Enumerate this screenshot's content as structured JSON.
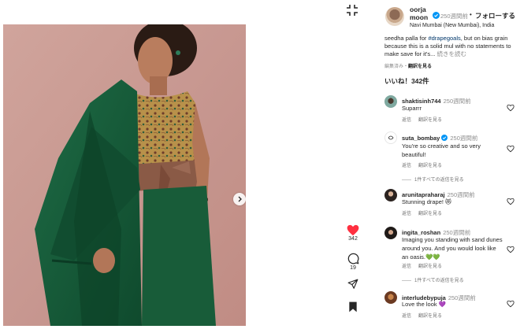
{
  "post": {
    "username": "oorjamoon",
    "time": "250週間前",
    "follow_label": "フォローする",
    "dot": "•",
    "location": "Navi Mumbai (New Mumbai), India"
  },
  "caption": {
    "pre": "seedha palla for ",
    "hashtag": "#drapegoals",
    "post": ", but on bias grain because this is a solid mul with no statements to make save for it's...",
    "more": "続きを読む",
    "edited": "編集済み",
    "dot": "・",
    "translate": "翻訳を見る"
  },
  "likes_label": "いいね！342件",
  "actions": {
    "like_count": "342",
    "comment_count": "19"
  },
  "comments": [
    {
      "user": "shaktisinh744",
      "time": "250週間前",
      "text": "Suparrr",
      "reply": "返信",
      "translate": "翻訳を見る",
      "verified": false
    },
    {
      "user": "suta_bombay",
      "time": "250週間前",
      "text": "You're so creative and so very beautiful!",
      "reply": "返信",
      "translate": "翻訳を見る",
      "verified": true,
      "replies": "1件すべての返信を見る"
    },
    {
      "user": "arunitapraharaj",
      "time": "250週間前",
      "text": "Stunning drape! 😻",
      "reply": "返信",
      "translate": "翻訳を見る",
      "verified": false
    },
    {
      "user": "ingita_roshan",
      "time": "250週間前",
      "text": "Imaging you standing with sand dunes around you. And you would look like an oasis.💚💚",
      "reply": "返信",
      "translate": "翻訳を見る",
      "verified": false,
      "replies": "1件すべての返信を見る"
    },
    {
      "user": "interludebypuja",
      "time": "250週間前",
      "text": "Love the look 💜",
      "reply": "返信",
      "translate": "翻訳を見る",
      "verified": false
    }
  ],
  "icons": {
    "collapse": "collapse-icon",
    "next": "chevron-right-icon",
    "like": "heart-filled-icon",
    "comment": "comment-icon",
    "share": "send-icon",
    "save": "bookmark-icon"
  },
  "colors": {
    "like_red": "#ff3040",
    "verified_blue": "#0095f6",
    "link": "#00376b",
    "muted": "#8e8e8e"
  }
}
